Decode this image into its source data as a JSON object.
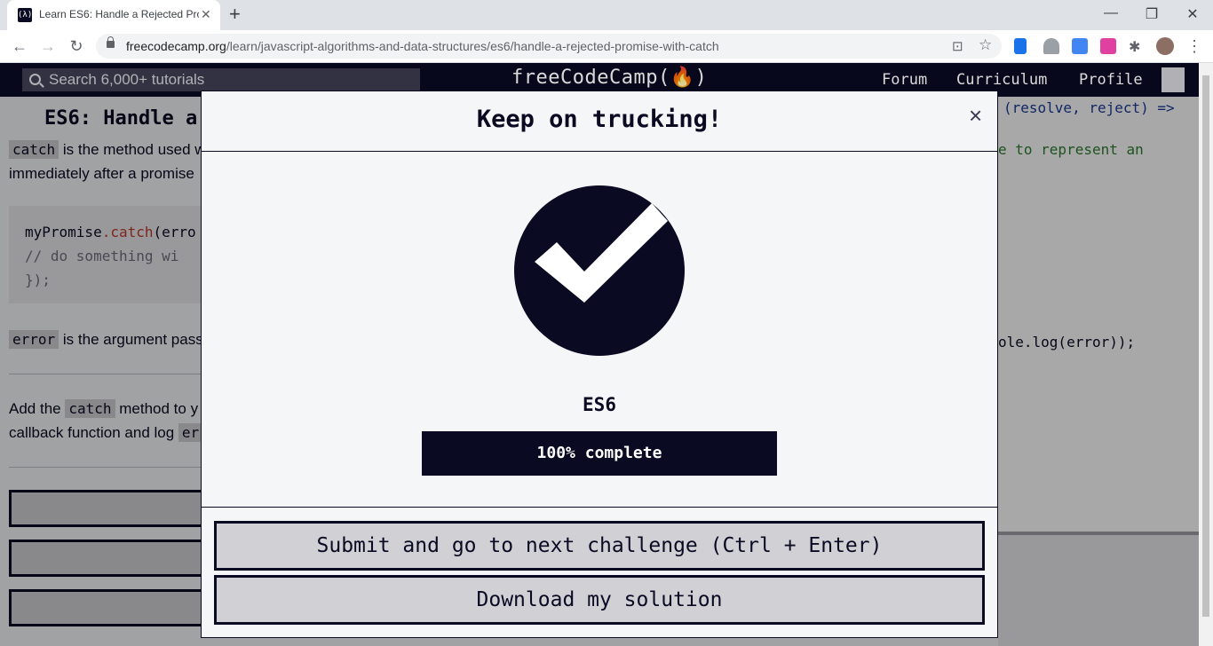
{
  "browser": {
    "tab_title": "Learn ES6: Handle a Rejected Pro",
    "tab_favicon": "(λ)",
    "url_host": "freecodecamp.org",
    "url_path": "/learn/javascript-algorithms-and-data-structures/es6/handle-a-rejected-promise-with-catch"
  },
  "site_nav": {
    "search_placeholder": "Search 6,000+ tutorials",
    "logo": "freeCodeCamp(🔥)",
    "links": [
      "Forum",
      "Curriculum",
      "Profile"
    ]
  },
  "lesson": {
    "title": "ES6: Handle a",
    "para1_code": "catch",
    "para1_text": "is the method used w",
    "para1_line2": "immediately after a promise",
    "code_lines": [
      "myPromise.catch(erro",
      "  // do something wi",
      "});"
    ],
    "code_method": ".catch",
    "para2_code": "error",
    "para2_text": "is the argument pass",
    "para3_prefix": "Add the",
    "para3_code": "catch",
    "para3_text": "method to y",
    "para3_line2": "callback function and log",
    "para3_code2": "er"
  },
  "editor": {
    "line_top": "(resolve, reject) =>",
    "line_comment": "e to represent an",
    "line_log": "ole.log(error));"
  },
  "modal": {
    "title": "Keep on trucking!",
    "close_label": "×",
    "block_name": "ES6",
    "progress_percent": 100,
    "progress_label": "100% complete",
    "submit_label": "Submit and go to next challenge (Ctrl + Enter)",
    "download_label": "Download my solution"
  },
  "colors": {
    "brand_dark": "#0a0a23",
    "modal_bg": "#f5f6f7",
    "button_bg": "#d0d0d5"
  }
}
